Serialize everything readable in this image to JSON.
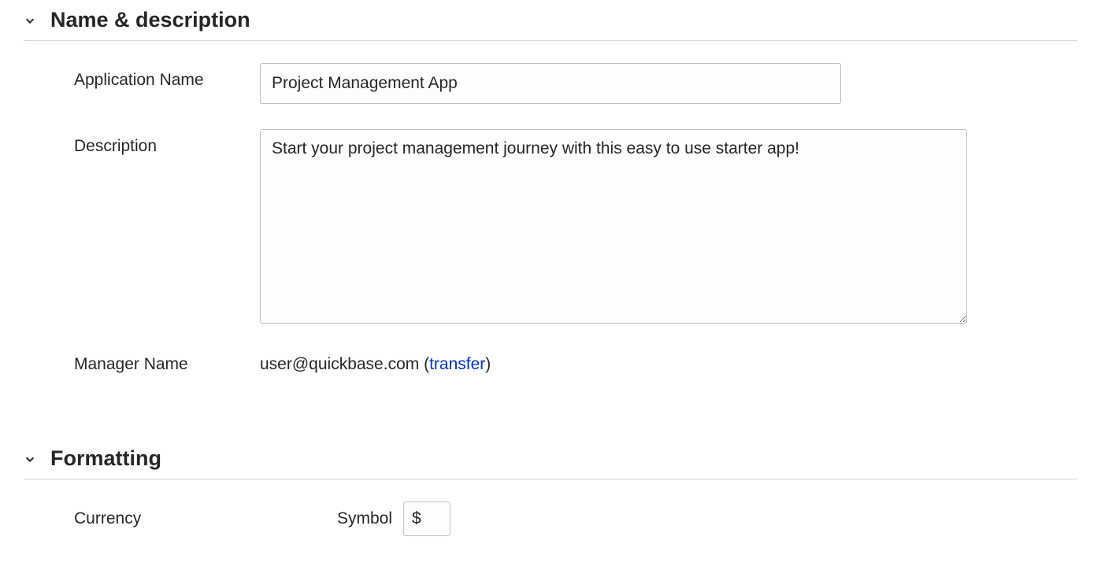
{
  "sections": {
    "name_desc": {
      "title": "Name & description",
      "app_name_label": "Application Name",
      "app_name_value": "Project Management App",
      "description_label": "Description",
      "description_value": "Start your project management journey with this easy to use starter app!",
      "manager_label": "Manager Name",
      "manager_email": "user@quickbase.com",
      "transfer_link": "transfer"
    },
    "formatting": {
      "title": "Formatting",
      "currency_label": "Currency",
      "symbol_label": "Symbol",
      "symbol_value": "$"
    }
  }
}
